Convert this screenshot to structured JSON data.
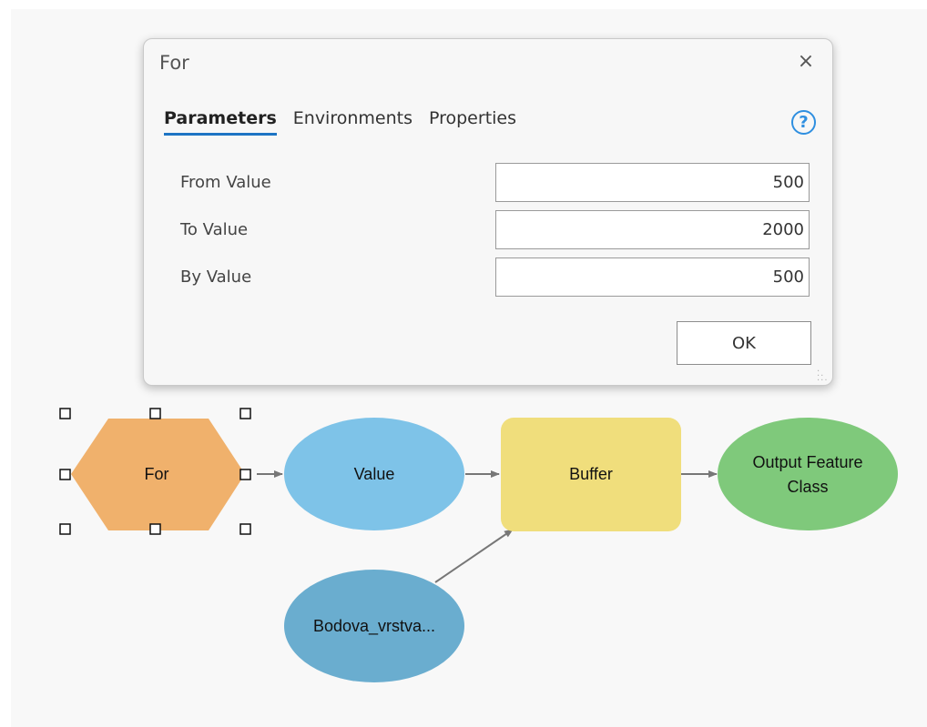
{
  "dialog": {
    "title": "For",
    "close_label": "×",
    "tabs": [
      {
        "label": "Parameters",
        "active": true
      },
      {
        "label": "Environments",
        "active": false
      },
      {
        "label": "Properties",
        "active": false
      }
    ],
    "help_label": "?",
    "params": [
      {
        "label": "From Value",
        "value": "500"
      },
      {
        "label": "To Value",
        "value": "2000"
      },
      {
        "label": "By Value",
        "value": "500"
      }
    ],
    "ok_label": "OK"
  },
  "model": {
    "nodes": {
      "for": {
        "label": "For",
        "color": "#f0b16c"
      },
      "value": {
        "label": "Value",
        "color": "#7ec3e8"
      },
      "buffer": {
        "label": "Buffer",
        "color": "#f0de7c"
      },
      "output": {
        "label_line1": "Output Feature",
        "label_line2": "Class",
        "color": "#7fc97b"
      },
      "input_layer": {
        "label": "Bodova_vrstva...",
        "color": "#6aadcf"
      }
    },
    "connector_color": "#777777"
  }
}
